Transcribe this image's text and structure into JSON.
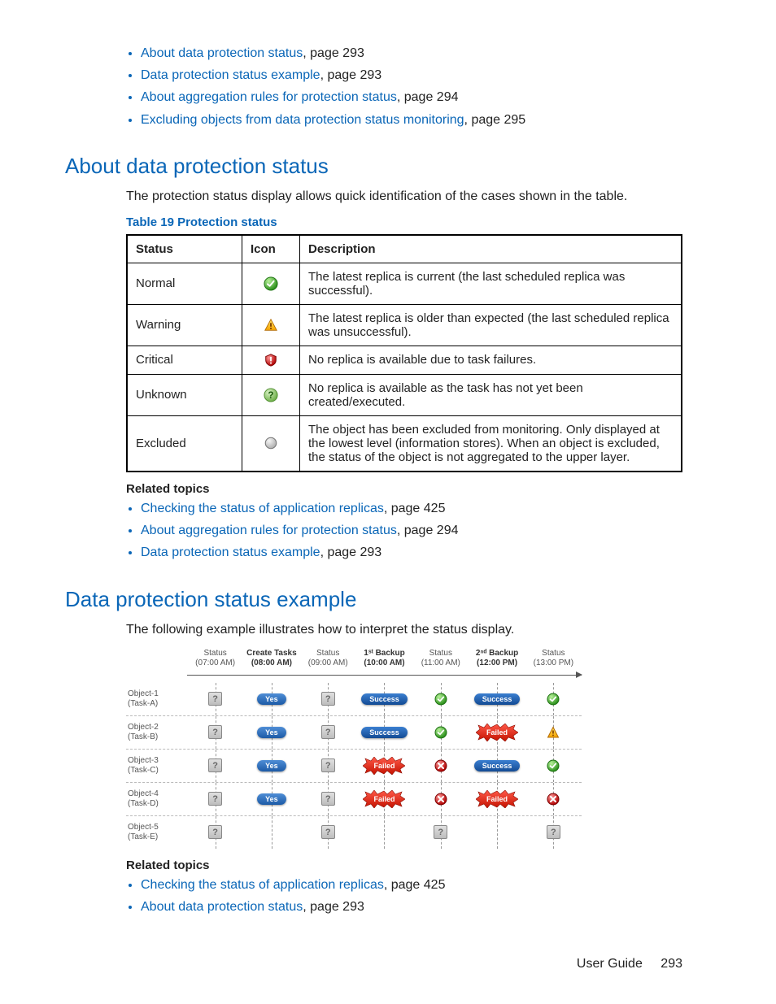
{
  "top_links": [
    {
      "text": "About data protection status",
      "page": "293"
    },
    {
      "text": "Data protection status example",
      "page": "293"
    },
    {
      "text": "About aggregation rules for protection status",
      "page": "294"
    },
    {
      "text": "Excluding objects from data protection status monitoring",
      "page": "295"
    }
  ],
  "section1": {
    "heading": "About data protection status",
    "intro": "The protection status display allows quick identification of the cases shown in the table.",
    "table_caption": "Table 19 Protection status",
    "headers": {
      "status": "Status",
      "icon": "Icon",
      "description": "Description"
    },
    "rows": [
      {
        "status": "Normal",
        "icon": "check-green",
        "desc": "The latest replica is current (the last scheduled replica was successful)."
      },
      {
        "status": "Warning",
        "icon": "warn-triangle",
        "desc": "The latest replica is older than expected (the last scheduled replica was unsuccessful)."
      },
      {
        "status": "Critical",
        "icon": "critical-shield",
        "desc": "No replica is available due to task failures."
      },
      {
        "status": "Unknown",
        "icon": "question-green",
        "desc": "No replica is available as the task has not yet been created/executed."
      },
      {
        "status": "Excluded",
        "icon": "excluded-circle",
        "desc": "The object has been excluded from monitoring. Only displayed at the lowest level (information stores). When an object is excluded, the status of the object is not aggregated to the upper layer."
      }
    ],
    "related_heading": "Related topics",
    "related": [
      {
        "text": "Checking the status of application replicas",
        "page": "425"
      },
      {
        "text": "About aggregation rules for protection status",
        "page": "294"
      },
      {
        "text": "Data protection status example",
        "page": "293"
      }
    ]
  },
  "section2": {
    "heading": "Data protection status example",
    "intro": "The following example illustrates how to interpret the status display.",
    "diagram": {
      "columns": [
        {
          "line1": "Status",
          "line2": "(07:00 AM)",
          "bold": false
        },
        {
          "line1": "Create Tasks",
          "line2": "(08:00 AM)",
          "bold": true
        },
        {
          "line1": "Status",
          "line2": "(09:00 AM)",
          "bold": false
        },
        {
          "line1": "1ˢᵗ Backup",
          "line2": "(10:00 AM)",
          "bold": true
        },
        {
          "line1": "Status",
          "line2": "(11:00 AM)",
          "bold": false
        },
        {
          "line1": "2ⁿᵈ Backup",
          "line2": "(12:00 PM)",
          "bold": true
        },
        {
          "line1": "Status",
          "line2": "(13:00 PM)",
          "bold": false
        }
      ],
      "rows": [
        {
          "obj_line1": "Object-1",
          "obj_line2": "(Task-A)",
          "cells": [
            "unk",
            "yes",
            "unk",
            "success",
            "ok",
            "success",
            "ok"
          ]
        },
        {
          "obj_line1": "Object-2",
          "obj_line2": "(Task-B)",
          "cells": [
            "unk",
            "yes",
            "unk",
            "success",
            "ok",
            "failed",
            "warn"
          ]
        },
        {
          "obj_line1": "Object-3",
          "obj_line2": "(Task-C)",
          "cells": [
            "unk",
            "yes",
            "unk",
            "failed",
            "err",
            "success",
            "ok"
          ]
        },
        {
          "obj_line1": "Object-4",
          "obj_line2": "(Task-D)",
          "cells": [
            "unk",
            "yes",
            "unk",
            "failed",
            "err",
            "failed",
            "err"
          ]
        },
        {
          "obj_line1": "Object-5",
          "obj_line2": "(Task-E)",
          "cells": [
            "unk",
            "",
            "unk",
            "",
            "unk",
            "",
            "unk"
          ]
        }
      ]
    },
    "related_heading": "Related topics",
    "related": [
      {
        "text": "Checking the status of application replicas",
        "page": "425"
      },
      {
        "text": "About data protection status",
        "page": "293"
      }
    ]
  },
  "footer": {
    "label": "User Guide",
    "page": "293"
  },
  "pill_text": {
    "yes": "Yes",
    "success": "Success",
    "failed": "Failed"
  }
}
